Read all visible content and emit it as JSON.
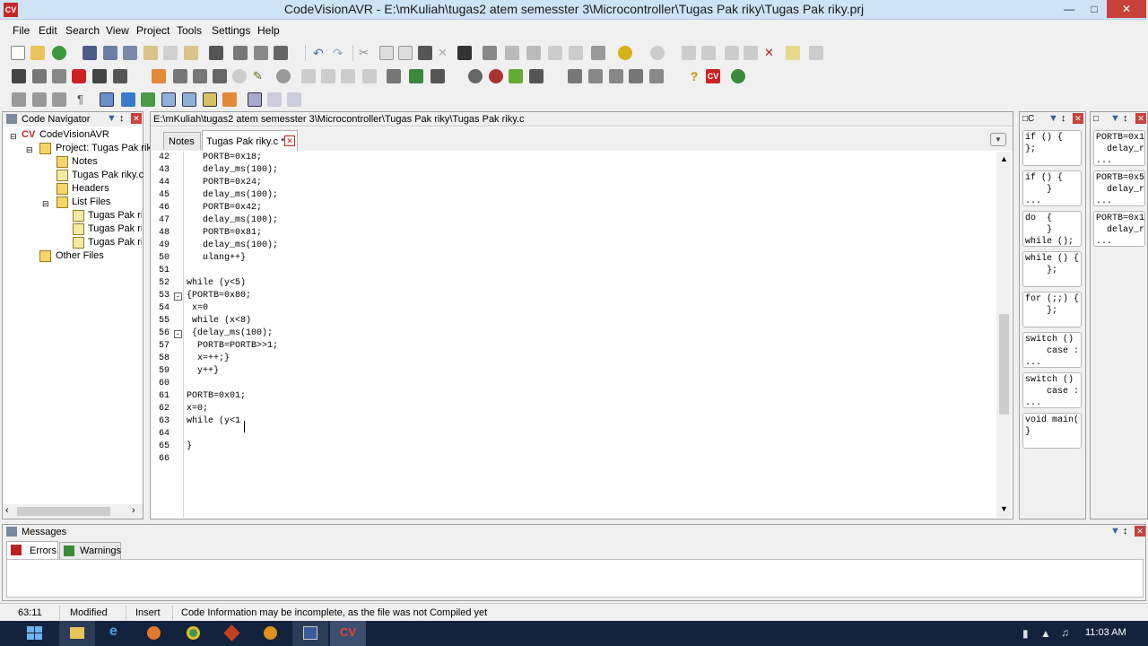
{
  "window": {
    "title": "CodeVisionAVR - E:\\mKuliah\\tugas2 atem semesster 3\\Microcontroller\\Tugas Pak riky\\Tugas Pak riky.prj",
    "logo": "CV"
  },
  "menu": [
    "File",
    "Edit",
    "Search",
    "View",
    "Project",
    "Tools",
    "Settings",
    "Help"
  ],
  "navigator": {
    "title": "Code Navigator",
    "items": [
      {
        "label": "CodeVisionAVR",
        "icon": "cv-icon"
      },
      {
        "label": "Project: Tugas Pak rik",
        "icon": "project-icon"
      },
      {
        "label": "Notes",
        "icon": "folder-icon"
      },
      {
        "label": "Tugas Pak riky.c",
        "icon": "file-icon"
      },
      {
        "label": "Headers",
        "icon": "folder-icon"
      },
      {
        "label": "List Files",
        "icon": "folder-icon"
      },
      {
        "label": "Tugas Pak rik",
        "icon": "file-icon"
      },
      {
        "label": "Tugas Pak rik",
        "icon": "file-icon"
      },
      {
        "label": "Tugas Pak rik",
        "icon": "file-icon"
      },
      {
        "label": "Other Files",
        "icon": "folder-icon"
      }
    ]
  },
  "editor": {
    "path": "E:\\mKuliah\\tugas2 atem semesster 3\\Microcontroller\\Tugas Pak riky\\Tugas Pak riky.c",
    "tabs": [
      {
        "label": "Notes"
      },
      {
        "label": "Tugas Pak riky.c *"
      }
    ],
    "lines": [
      {
        "n": "42",
        "t": "   PORTB=0x18;"
      },
      {
        "n": "43",
        "t": "   delay_ms(100);"
      },
      {
        "n": "44",
        "t": "   PORTB=0x24;"
      },
      {
        "n": "45",
        "t": "   delay_ms(100);"
      },
      {
        "n": "46",
        "t": "   PORTB=0x42;"
      },
      {
        "n": "47",
        "t": "   delay_ms(100);"
      },
      {
        "n": "48",
        "t": "   PORTB=0x81;"
      },
      {
        "n": "49",
        "t": "   delay_ms(100);"
      },
      {
        "n": "50",
        "t": "   ulang++}"
      },
      {
        "n": "51",
        "t": ""
      },
      {
        "n": "52",
        "t": "while (y<5)"
      },
      {
        "n": "53",
        "t": "{PORTB=0x80;"
      },
      {
        "n": "54",
        "t": " x=0"
      },
      {
        "n": "55",
        "t": " while (x<8)"
      },
      {
        "n": "56",
        "t": " {delay_ms(100);"
      },
      {
        "n": "57",
        "t": "  PORTB=PORTB>>1;"
      },
      {
        "n": "58",
        "t": "  x=++;}"
      },
      {
        "n": "59",
        "t": "  y++}"
      },
      {
        "n": "60",
        "t": ""
      },
      {
        "n": "61",
        "t": "PORTB=0x01;"
      },
      {
        "n": "62",
        "t": "x=0;"
      },
      {
        "n": "63",
        "t": "while (y<1"
      },
      {
        "n": "64",
        "t": ""
      },
      {
        "n": "65",
        "t": "}"
      },
      {
        "n": "66",
        "t": ""
      }
    ]
  },
  "snippets_a": [
    "if () {\n};",
    "if () {\n    }\n...",
    "do  {\n    }\nwhile ();",
    "while () {\n    };",
    "for (;;) {\n    };",
    "switch ()\n    case :\n...",
    "switch ()\n    case :\n...",
    "void main(\n}"
  ],
  "snippets_b": [
    "PORTB=0x1\n  delay_r\n...",
    "PORTB=0x5\n  delay_r\n...",
    "PORTB=0x1\n  delay_r\n..."
  ],
  "messages": {
    "title": "Messages",
    "tabs": [
      "Errors",
      "Warnings"
    ]
  },
  "status": {
    "position": "63:11",
    "modified": "Modified",
    "mode": "Insert",
    "info": "Code Information may be incomplete, as the file was not Compiled yet"
  },
  "taskbar": {
    "time": "11:03 AM"
  }
}
